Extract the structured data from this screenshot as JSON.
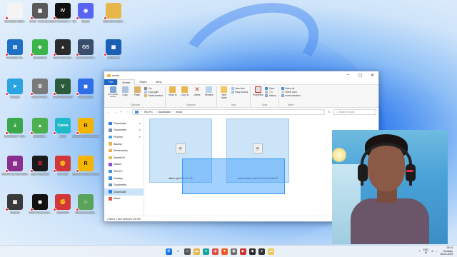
{
  "desktop_icons": [
    {
      "label": "Valid Aspire Maths...",
      "color": "#f4f4f4",
      "glyph": "",
      "fg": "#333"
    },
    {
      "label": "GTAVI - Hindi Dub...",
      "color": "#5a5a5a",
      "glyph": "▣",
      "fg": "#fff"
    },
    {
      "label": "Grand Theft Auto V - The Trilogy",
      "color": "#111",
      "glyph": "IV",
      "fg": "#fff"
    },
    {
      "label": "Discord",
      "color": "#5865f2",
      "glyph": "◉",
      "fg": "#fff"
    },
    {
      "label": "Hindi Mod Collecti...",
      "color": "#e8b74b",
      "glyph": "",
      "fg": "#fff"
    },
    {
      "label": "Cl Realistic 3D...",
      "color": "#1e70c6",
      "glyph": "▤",
      "fg": "#fff"
    },
    {
      "label": "BlueStacks 5",
      "color": "#39b54a",
      "glyph": "◆",
      "fg": "#fff"
    },
    {
      "label": "Grand Theft Auto...",
      "color": "#2a2a2a",
      "glyph": "▲",
      "fg": "#fff"
    },
    {
      "label": "Grand Theft Auto...",
      "color": "#3a4d6a",
      "glyph": "GS",
      "fg": "#fff"
    },
    {
      "label": "Explorer.exe",
      "color": "#1a5fb4",
      "glyph": "▦",
      "fg": "#fff"
    },
    {
      "label": "Telegram",
      "color": "#2aa3e0",
      "glyph": "➤",
      "fg": "#fff"
    },
    {
      "label": "Realistic Bikes...",
      "color": "#7a7a7a",
      "glyph": "⚙",
      "fg": "#fff"
    },
    {
      "label": "Grand Theft Auto V",
      "color": "#2d5a3a",
      "glyph": "V",
      "fg": "#fff"
    },
    {
      "label": "Roblox Studio",
      "color": "#2f6ee6",
      "glyph": "◼",
      "fg": "#fff"
    },
    {
      "label": "CleanMaster + Box...",
      "color": "#3aa84a",
      "glyph": "⤓",
      "fg": "#fff"
    },
    {
      "label": "BlueStacks...",
      "color": "#4caf50",
      "glyph": "▲",
      "fg": "#fff"
    },
    {
      "label": "Canva",
      "color": "#20b9c9",
      "glyph": "Canva",
      "fg": "#fff"
    },
    {
      "label": "Rockstar Games Launcher",
      "color": "#f5b400",
      "glyph": "R",
      "fg": "#111"
    },
    {
      "label": "WinRAR Zip Hindi 2023...",
      "color": "#8b2f8f",
      "glyph": "▥",
      "fg": "#fff"
    },
    {
      "label": "Sonic Generation",
      "color": "#1b1b1b",
      "glyph": "✪",
      "fg": "#e23"
    },
    {
      "label": "Riot Client",
      "color": "#d13639",
      "glyph": "✊",
      "fg": "#fff"
    },
    {
      "label": "Rockstar Games Launcher",
      "color": "#f5b400",
      "glyph": "R",
      "fg": "#111"
    },
    {
      "label": "Snapshot",
      "color": "#3a3a3a",
      "glyph": "▦",
      "fg": "#fff"
    },
    {
      "label": "GTAV Privacy Guar...",
      "color": "#111",
      "glyph": "◉",
      "fg": "#fff"
    },
    {
      "label": "VALORANT",
      "color": "#d13639",
      "glyph": "✊",
      "fg": "#fff"
    },
    {
      "label": "Minecraft Jasutus...",
      "color": "#5aa35a",
      "glyph": "☺",
      "fg": "#fff"
    }
  ],
  "window": {
    "title": "mods",
    "tabs": [
      "File",
      "Home",
      "Share",
      "View"
    ],
    "ribbon": {
      "clipboard": {
        "name": "Clipboard",
        "pin": "Pin to Quick access",
        "copy": "Copy",
        "paste": "Paste",
        "cut": "Cut",
        "copy_path": "Copy path",
        "paste_shortcut": "Paste shortcut"
      },
      "organize": {
        "name": "Organize",
        "move_to": "Move to",
        "copy_to": "Copy to",
        "delete": "Delete",
        "rename": "Rename"
      },
      "new": {
        "name": "New",
        "new_folder": "New folder",
        "new_item": "New item",
        "easy_access": "Easy access"
      },
      "open": {
        "name": "Open",
        "properties": "Properties",
        "open": "Open",
        "edit": "Edit",
        "history": "History"
      },
      "select": {
        "name": "Select",
        "select_all": "Select all",
        "select_none": "Select none",
        "invert": "Invert selection"
      }
    },
    "breadcrumb": [
      "This PC",
      "Downloads",
      "mods"
    ],
    "search_placeholder": "Search mods",
    "nav_items": [
      {
        "label": "Downloads",
        "color": "#2a7de1",
        "pinned": true,
        "selected": false
      },
      {
        "label": "Documents",
        "color": "#6f8fb5",
        "pinned": true,
        "selected": false
      },
      {
        "label": "Pictures",
        "color": "#4aa3df",
        "pinned": true,
        "selected": false
      },
      {
        "label": "Backup",
        "color": "#e8b74b",
        "pinned": false,
        "selected": false
      },
      {
        "label": "Screenshots",
        "color": "#e8b74b",
        "pinned": false,
        "selected": false
      },
      {
        "label": "System32",
        "color": "#e8b74b",
        "pinned": false,
        "selected": false
      },
      {
        "label": "Videos",
        "color": "#8a4fd4",
        "pinned": false,
        "selected": false
      },
      {
        "label": "This PC",
        "color": "#3b8fd8",
        "pinned": false,
        "selected": false
      },
      {
        "label": "Desktop",
        "color": "#3b8fd8",
        "pinned": false,
        "selected": false
      },
      {
        "label": "Documents",
        "color": "#6f8fb5",
        "pinned": false,
        "selected": false
      },
      {
        "label": "Downloads",
        "color": "#2a7de1",
        "pinned": false,
        "selected": true
      },
      {
        "label": "Music",
        "color": "#e25a4a",
        "pinned": false,
        "selected": false
      }
    ],
    "files": [
      {
        "name": "fabric-api-0.83.0+1.20"
      },
      {
        "name": "sodium-fabric-mc1.20-0.4.10+build.27"
      }
    ],
    "status": "2 items    1 item selected  733 KB"
  },
  "taskbar": {
    "language": "ENG",
    "region": "IN",
    "time": "09:24",
    "day": "Thursday",
    "date": "06-06-2023"
  }
}
